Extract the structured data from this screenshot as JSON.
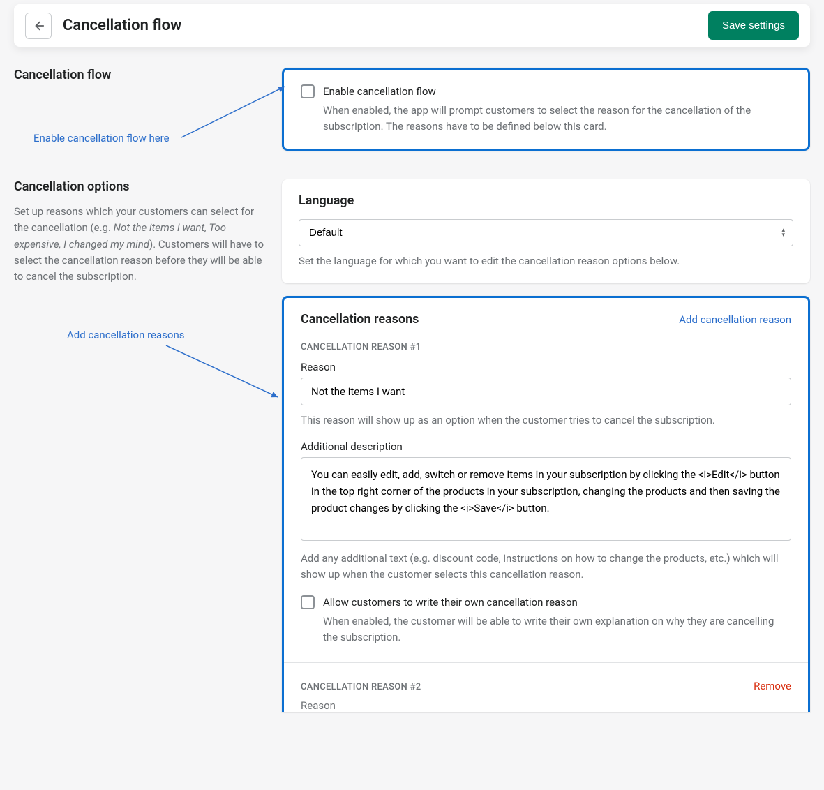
{
  "header": {
    "title": "Cancellation flow",
    "save_label": "Save settings"
  },
  "section_flow": {
    "title": "Cancellation flow",
    "annotation": "Enable cancellation flow here",
    "checkbox_label": "Enable cancellation flow",
    "checkbox_help": "When enabled, the app will prompt customers to select the reason for the cancellation of the subscription. The reasons have to be defined below this card."
  },
  "section_options": {
    "title": "Cancellation options",
    "desc_pre": "Set up reasons which your customers can select for the cancellation (e.g. ",
    "desc_em": "Not the items I want, Too expensive, I changed my mind",
    "desc_post": "). Customers will have to select the cancellation reason before they will be able to cancel the subscription.",
    "annotation": "Add cancellation reasons",
    "language": {
      "title": "Language",
      "selected": "Default",
      "help": "Set the language for which you want to edit the cancellation reason options below."
    },
    "reasons_card": {
      "title": "Cancellation reasons",
      "add_label": "Add cancellation reason",
      "reason1": {
        "block_label": "CANCELLATION REASON #1",
        "reason_label": "Reason",
        "reason_value": "Not the items I want",
        "reason_help": "This reason will show up as an option when the customer tries to cancel the subscription.",
        "desc_label": "Additional description",
        "desc_value": "You can easily edit, add, switch or remove items in your subscription by clicking the <i>Edit</i> button in the top right corner of the products in your subscription, changing the products and then saving the product changes by clicking the <i>Save</i> button.",
        "desc_help": "Add any additional text (e.g. discount code, instructions on how to change the products, etc.) which will show up when the customer selects this cancellation reason.",
        "allow_label": "Allow customers to write their own cancellation reason",
        "allow_help": "When enabled, the customer will be able to write their own explanation on why they are cancelling the subscription."
      },
      "reason2": {
        "block_label": "CANCELLATION REASON #2",
        "remove_label": "Remove",
        "reason_label": "Reason"
      }
    }
  }
}
